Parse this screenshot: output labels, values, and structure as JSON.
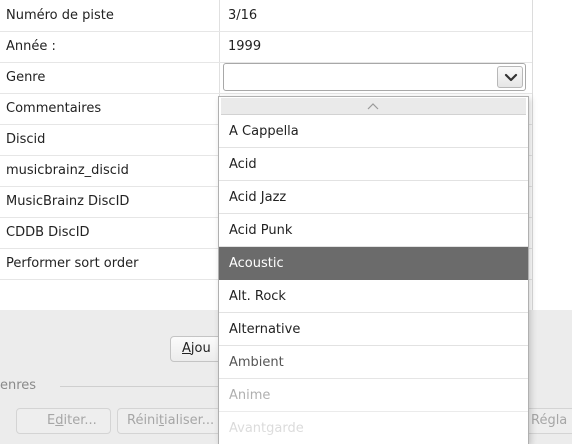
{
  "properties": {
    "rows": [
      {
        "key": "Numéro de piste",
        "value": "3/16"
      },
      {
        "key": "Année :",
        "value": "1999"
      },
      {
        "key": "Genre",
        "value": ""
      },
      {
        "key": "Commentaires",
        "value": ""
      },
      {
        "key": "Discid",
        "value": ""
      },
      {
        "key": "musicbrainz_discid",
        "value": ""
      },
      {
        "key": "MusicBrainz DiscID",
        "value": ""
      },
      {
        "key": "CDDB DiscID",
        "value": ""
      },
      {
        "key": "Performer sort order",
        "value": ""
      }
    ]
  },
  "genre_combo": {
    "value": "",
    "icon": "chevron-down-icon"
  },
  "dropdown": {
    "scroll_up_icon": "chevron-up-icon",
    "items": [
      "A Cappella",
      "Acid",
      "Acid Jazz",
      "Acid Punk",
      "Acoustic",
      "Alt. Rock",
      "Alternative",
      "Ambient",
      "Anime",
      "Avantgarde"
    ],
    "selected": "Acoustic"
  },
  "bottom": {
    "add_button": {
      "label_underlined": "A",
      "label_rest": "jou"
    },
    "group_label": "enres",
    "edit_button": {
      "label_pre": "E",
      "label_underlined": "d",
      "label_post": "iter..."
    },
    "reset_button": {
      "label_pre": "Réini",
      "label_underlined": "t",
      "label_post": "ialiser..."
    },
    "settings_button": {
      "label": "Régla"
    }
  },
  "colors": {
    "selection": "#6b6b6b",
    "panel_background": "#ececec"
  }
}
